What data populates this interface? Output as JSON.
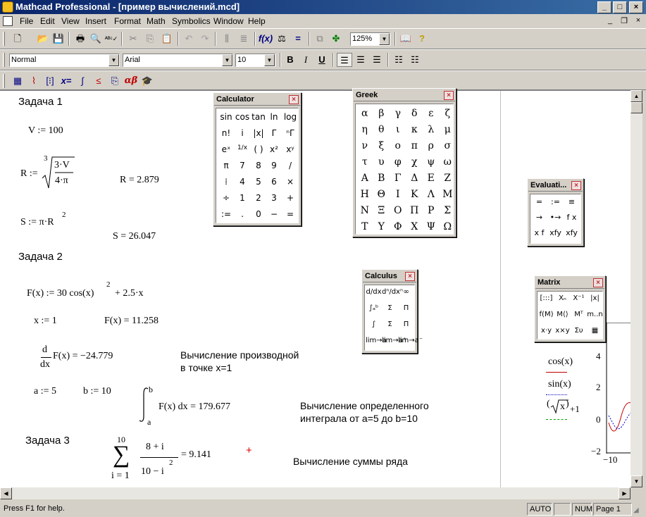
{
  "window": {
    "title": "Mathcad Professional - [пример вычислений.mcd]"
  },
  "menu": {
    "items": [
      "File",
      "Edit",
      "View",
      "Insert",
      "Format",
      "Math",
      "Symbolics",
      "Window",
      "Help"
    ]
  },
  "toolbar": {
    "zoom": "125%"
  },
  "format_bar": {
    "style": "Normal",
    "font": "Arial",
    "size": "10",
    "bold": "B",
    "italic": "I",
    "underline": "U"
  },
  "worksheet": {
    "task1": "Задача 1",
    "task2": "Задача 2",
    "task3": "Задача 3",
    "v_def": "V := 100",
    "r_lhs": "R :=",
    "r_root_index": "3",
    "r_num": "3·V",
    "r_den": "4·π",
    "r_result": "R = 2.879",
    "s_def": "S := π·R",
    "s_exp": "2",
    "s_result": "S = 26.047",
    "f_def": "F(x) := 30 cos(x)",
    "f_exp": "2",
    "f_def_tail": "+ 2.5·x",
    "x_def": "x := 1",
    "f_result": "F(x) = 11.258",
    "deriv_d": "d",
    "deriv_dx": "dx",
    "deriv_result": "F(x) = −24.779",
    "deriv_note_1": "Вычисление производной",
    "deriv_note_2": "в точке x=1",
    "a_def": "a := 5",
    "b_def": "b := 10",
    "int_upper": "b",
    "int_lower": "a",
    "int_result": "F(x) dx = 179.677",
    "int_note_1": "Вычисление определенного",
    "int_note_2": "интеграла от a=5 до b=10",
    "sum_upper": "10",
    "sum_lower": "i = 1",
    "sum_num": "8 + i",
    "sum_den": "10 − i",
    "sum_den_exp": "2",
    "sum_result": "= 9.141",
    "sum_note": "Вычисление суммы ряда",
    "legend_cos": "cos(x)",
    "legend_sin": "sin(x)",
    "legend_sqrt": "x",
    "legend_sqrt_tail": "+1",
    "plot_y_ticks": [
      "4",
      "2",
      "0",
      "−2"
    ],
    "plot_x_tick": "−10"
  },
  "palettes": {
    "calculator": {
      "title": "Calculator",
      "rows": [
        [
          "sin",
          "cos",
          "tan",
          "ln",
          "log"
        ],
        [
          "n!",
          "i",
          "|x|",
          "Γ",
          "ⁿΓ"
        ],
        [
          "eˣ",
          "1/x",
          "( )",
          "x²",
          "xʸ"
        ],
        [
          "π",
          "7",
          "8",
          "9",
          "/"
        ],
        [
          "⁞",
          "4",
          "5",
          "6",
          "×"
        ],
        [
          "÷",
          "1",
          "2",
          "3",
          "+"
        ],
        [
          ":=",
          ".",
          "0",
          "−",
          "="
        ]
      ]
    },
    "greek": {
      "title": "Greek",
      "rows": [
        [
          "α",
          "β",
          "γ",
          "δ",
          "ε",
          "ζ"
        ],
        [
          "η",
          "θ",
          "ι",
          "κ",
          "λ",
          "μ"
        ],
        [
          "ν",
          "ξ",
          "ο",
          "π",
          "ρ",
          "σ"
        ],
        [
          "τ",
          "υ",
          "φ",
          "χ",
          "ψ",
          "ω"
        ],
        [
          "Α",
          "Β",
          "Γ",
          "Δ",
          "Ε",
          "Ζ"
        ],
        [
          "Η",
          "Θ",
          "Ι",
          "Κ",
          "Λ",
          "Μ"
        ],
        [
          "Ν",
          "Ξ",
          "Ο",
          "Π",
          "Ρ",
          "Σ"
        ],
        [
          "Τ",
          "Υ",
          "Φ",
          "Χ",
          "Ψ",
          "Ω"
        ]
      ]
    },
    "evaluation": {
      "title": "Evaluati...",
      "rows": [
        [
          "=",
          ":=",
          "≡"
        ],
        [
          "→",
          "•→",
          "f x"
        ],
        [
          "x f",
          "xfy",
          "xfy"
        ]
      ]
    },
    "calculus": {
      "title": "Calculus",
      "rows": [
        [
          "d/dx",
          "dⁿ/dxⁿ",
          "∞"
        ],
        [
          "∫ₐᵇ",
          "Σ",
          "Π"
        ],
        [
          "∫",
          "Σ",
          "Π"
        ],
        [
          "lim→a",
          "lim→a⁺",
          "lim→a⁻"
        ]
      ]
    },
    "matrix": {
      "title": "Matrix",
      "rows": [
        [
          "[:::]",
          "Xₙ",
          "X⁻¹",
          "|x|"
        ],
        [
          "f(M)",
          "M⟨⟩",
          "Mᵀ",
          "m..n"
        ],
        [
          "x·y",
          "x×y",
          "Συ",
          "▦"
        ]
      ]
    }
  },
  "statusbar": {
    "help": "Press F1 for help.",
    "auto": "AUTO",
    "num": "NUM",
    "page": "Page 1"
  }
}
